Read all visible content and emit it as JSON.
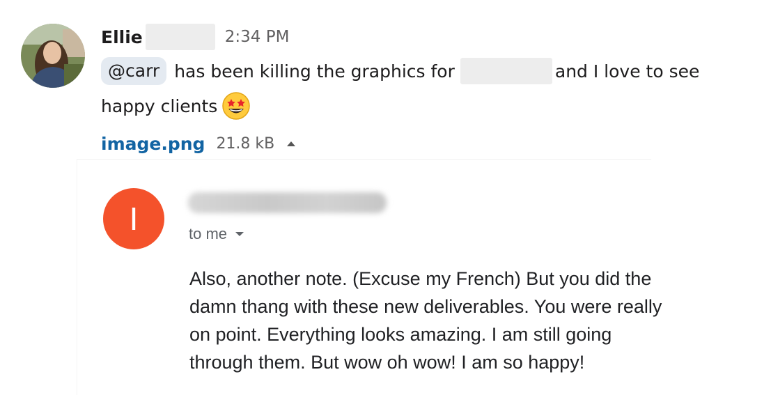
{
  "message": {
    "sender_name": "Ellie",
    "timestamp": "2:34 PM",
    "mention": "@carr",
    "text_part1": "has been killing the graphics for",
    "text_part2": "and I love to see",
    "text_part3": "happy clients",
    "emoji_icon": "star-struck-emoji-icon"
  },
  "attachment": {
    "file_name": "image.png",
    "file_size": "21.8 kB"
  },
  "email": {
    "sender_initial": "I",
    "sender_avatar_color": "#f4522b",
    "recipient_line": "to me",
    "body": "Also, another note. (Excuse my French) But you did the\ndamn thang with these new deliverables. You were really\non point. Everything looks amazing. I am still going\nthrough them. But wow oh wow! I am so happy!"
  },
  "colors": {
    "link": "#1264a3",
    "mention_bg": "#e4eaf1",
    "muted_text": "#616061"
  }
}
